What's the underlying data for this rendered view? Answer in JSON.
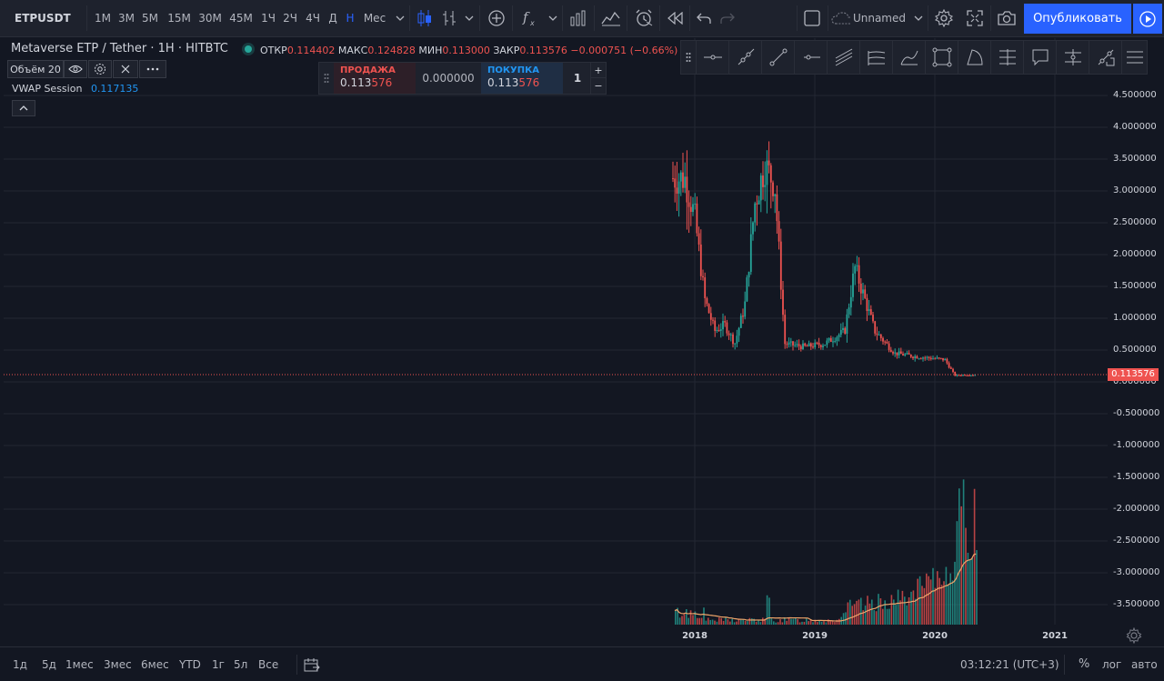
{
  "header": {
    "symbol": "ETPUSDT",
    "intervals": [
      "1М",
      "3М",
      "5М",
      "15М",
      "30М",
      "45М",
      "1Ч",
      "2Ч",
      "4Ч",
      "Д",
      "Н",
      "Мес"
    ],
    "active_interval": "Н",
    "layout_name": "Unnamed",
    "publish_label": "Опубликовать"
  },
  "legend": {
    "title": "Metaverse ETP / Tether · 1H · HITBTC",
    "open_label": "ОТКР",
    "open": "0.114402",
    "high_label": "МАКС",
    "high": "0.124828",
    "low_label": "МИН",
    "low": "0.113000",
    "close_label": "ЗАКР",
    "close": "0.113576",
    "change": "−0.000751 (−0.66%)",
    "volume_label": "Объём 20",
    "vwap_label": "VWAP Session",
    "vwap_value": "0.117135"
  },
  "trade": {
    "sell_label": "ПРОДАЖА",
    "sell_price_main": "0.113",
    "sell_price_frac": "576",
    "spread": "0.000000",
    "buy_label": "ПОКУПКА",
    "buy_price_main": "0.113",
    "buy_price_frac": "576",
    "qty": "1",
    "plus": "+",
    "minus": "−"
  },
  "price_axis": [
    "4.500000",
    "4.000000",
    "3.500000",
    "3.000000",
    "2.500000",
    "2.000000",
    "1.500000",
    "1.000000",
    "0.500000",
    "0.000000",
    "-0.500000",
    "-1.000000",
    "-1.500000",
    "-2.000000",
    "-2.500000",
    "-3.000000",
    "-3.500000"
  ],
  "current_price": "0.113576",
  "time_axis": [
    "2018",
    "2019",
    "2020",
    "2021"
  ],
  "bottom": {
    "ranges": [
      "1д",
      "5д",
      "1мес",
      "3мес",
      "6мес",
      "YTD",
      "1г",
      "5л",
      "Все"
    ],
    "clock": "03:12:21 (UTC+3)",
    "percent": "%",
    "log": "лог",
    "auto": "авто"
  },
  "colors": {
    "up": "#26a69a",
    "down": "#ef5350",
    "accent": "#2962ff",
    "bg": "#131722",
    "panel": "#1e222d"
  },
  "chart_data": {
    "type": "candlestick",
    "symbol": "ETPUSDT",
    "approx_closes": [
      {
        "x": "2017-12",
        "y": 3.2
      },
      {
        "x": "2018-01",
        "y": 2.6
      },
      {
        "x": "2018-02",
        "y": 1.3
      },
      {
        "x": "2018-03",
        "y": 0.8
      },
      {
        "x": "2018-04",
        "y": 0.9
      },
      {
        "x": "2018-05",
        "y": 0.6
      },
      {
        "x": "2018-06",
        "y": 1.2
      },
      {
        "x": "2018-07",
        "y": 2.8
      },
      {
        "x": "2018-08",
        "y": 3.4
      },
      {
        "x": "2018-09",
        "y": 3.1
      },
      {
        "x": "2018-10",
        "y": 0.6
      },
      {
        "x": "2018-12",
        "y": 0.55
      },
      {
        "x": "2019-02",
        "y": 0.6
      },
      {
        "x": "2019-04",
        "y": 0.8
      },
      {
        "x": "2019-05",
        "y": 1.8
      },
      {
        "x": "2019-06",
        "y": 1.3
      },
      {
        "x": "2019-07",
        "y": 0.8
      },
      {
        "x": "2019-09",
        "y": 0.45
      },
      {
        "x": "2019-11",
        "y": 0.4
      },
      {
        "x": "2020-02",
        "y": 0.35
      },
      {
        "x": "2020-03",
        "y": 0.1
      },
      {
        "x": "2020-04",
        "y": 0.11
      }
    ],
    "ylim": [
      -3.7,
      5.0
    ]
  }
}
